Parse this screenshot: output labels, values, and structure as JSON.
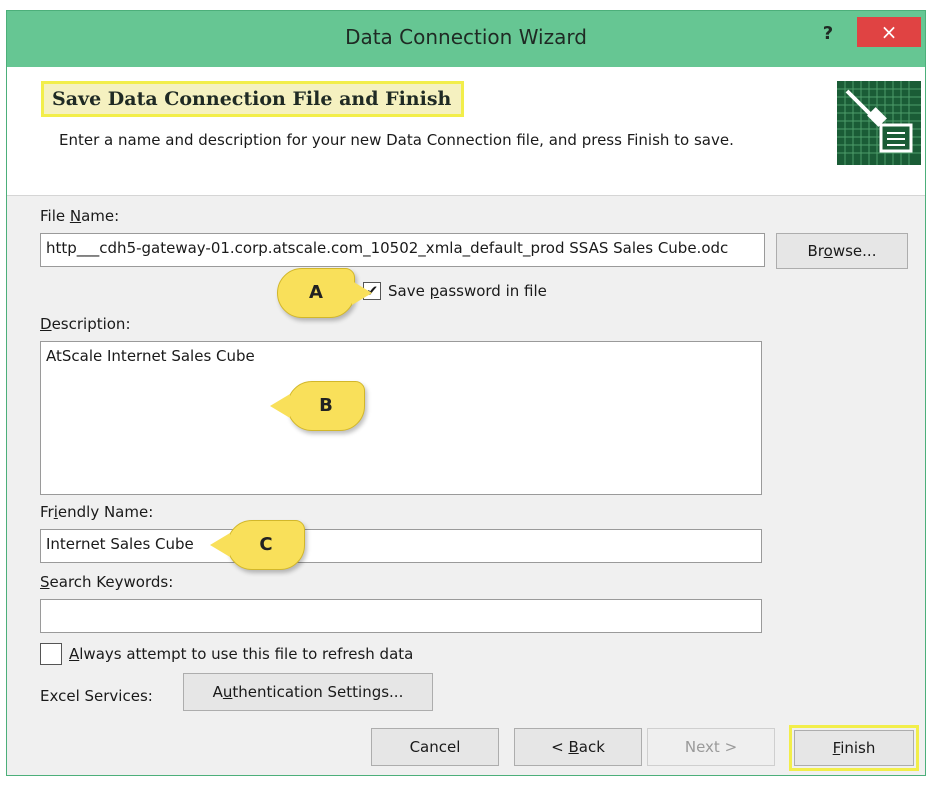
{
  "window": {
    "title": "Data Connection Wizard",
    "help": "?",
    "close": "×"
  },
  "header": {
    "title": "Save Data Connection File and Finish",
    "description": "Enter a name and description for your new Data Connection file, and press Finish to save."
  },
  "file_name": {
    "label_pre": "File ",
    "label_u": "N",
    "label_post": "ame:",
    "value": "http___cdh5-gateway-01.corp.atscale.com_10502_xmla_default_prod SSAS Sales Cube.odc",
    "browse_pre": "Br",
    "browse_u": "o",
    "browse_post": "wse..."
  },
  "save_password": {
    "pre": "Save ",
    "u": "p",
    "post": "assword in file",
    "checked": "✔"
  },
  "description": {
    "label_u": "D",
    "label_post": "escription:",
    "value": "AtScale Internet Sales Cube"
  },
  "friendly_name": {
    "label_pre": "Fr",
    "label_u": "i",
    "label_post": "endly Name:",
    "value": "Internet Sales Cube"
  },
  "search_keywords": {
    "label_u": "S",
    "label_post": "earch Keywords:",
    "value": ""
  },
  "always_refresh": {
    "u": "A",
    "post": "lways attempt to use this file to refresh data"
  },
  "excel_services": {
    "label": "Excel Services:",
    "auth_pre": "A",
    "auth_u": "u",
    "auth_post": "thentication Settings..."
  },
  "buttons": {
    "cancel": "Cancel",
    "back_pre": "< ",
    "back_u": "B",
    "back_post": "ack",
    "next": "Next >",
    "finish_u": "F",
    "finish_post": "inish"
  },
  "callouts": {
    "a": "A",
    "b": "B",
    "c": "C"
  },
  "colors": {
    "titlebar": "#66c693",
    "close": "#e04343",
    "highlight": "#f2ee4a",
    "callout": "#f9e05a"
  }
}
